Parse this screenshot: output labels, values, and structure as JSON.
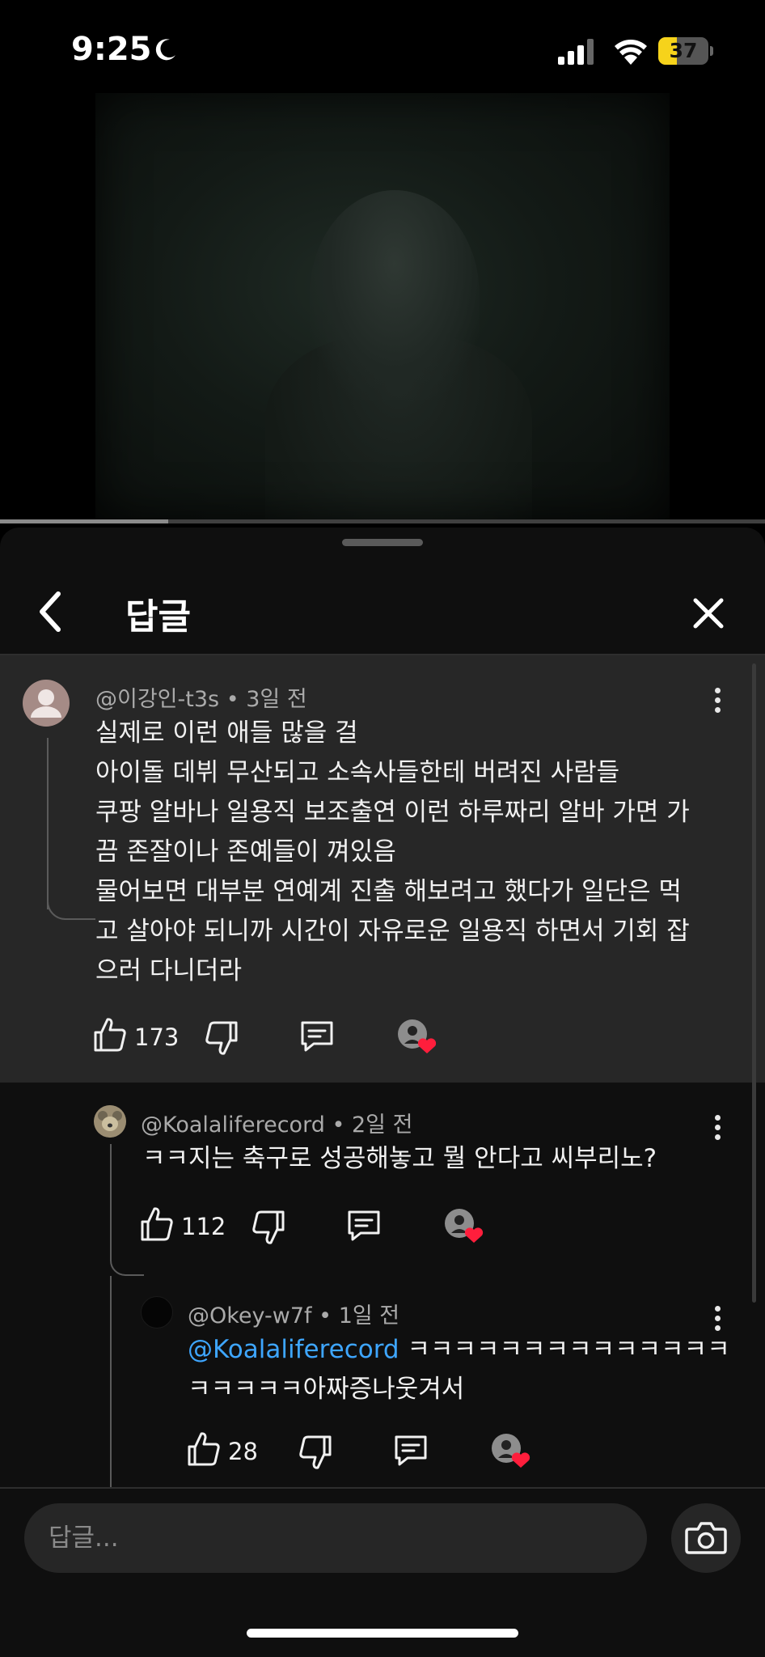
{
  "status_bar": {
    "time": "9:25",
    "battery_level": "37",
    "battery_fraction": 0.37,
    "icons": [
      "moon-icon",
      "cellular-signal-icon",
      "wifi-icon",
      "battery-icon"
    ]
  },
  "video": {
    "progress_fraction": 0.22
  },
  "sheet": {
    "title": "답글",
    "back_icon": "chevron-left-icon",
    "close_icon": "close-icon"
  },
  "comments": [
    {
      "handle": "@이강인-t3s",
      "separator": "•",
      "time": "3일 전",
      "lines": [
        "실제로 이런 애들 많을 걸",
        "아이돌 데뷔 무산되고 소속사들한테 버려진 사람들",
        "쿠팡 알바나 일용직 보조출연 이런 하루짜리 알바 가면 가",
        "끔 존잘이나 존예들이 껴있음",
        "물어보면 대부분 연예계 진출 해보려고 했다가 일단은 먹",
        "고 살아야 되니까 시간이 자유로운 일용직 하면서 기회 잡",
        "으러 다니더라"
      ],
      "likes": "173"
    },
    {
      "handle": "@Koalaliferecord",
      "separator": "•",
      "time": "2일 전",
      "lines": [
        "ㅋㅋ지는 축구로 성공해놓고 뭘 안다고 씨부리노?"
      ],
      "likes": "112"
    },
    {
      "handle": "@Okey-w7f",
      "separator": "•",
      "time": "1일 전",
      "mention": "@Koalaliferecord",
      "line1_rest": " ㅋㅋㅋㅋㅋㅋㅋㅋㅋㅋㅋㅋㅋㅋ",
      "line2": "ㅋㅋㅋㅋㅋ아짜증나웃겨서",
      "likes": "28"
    }
  ],
  "reply_box": {
    "placeholder": "답글...",
    "camera_icon": "camera-icon"
  },
  "colors": {
    "background": "#0f0f0f",
    "highlight": "#272727",
    "mention": "#3ea6ff",
    "heart": "#ff1e3c",
    "battery": "#f6d31b"
  }
}
